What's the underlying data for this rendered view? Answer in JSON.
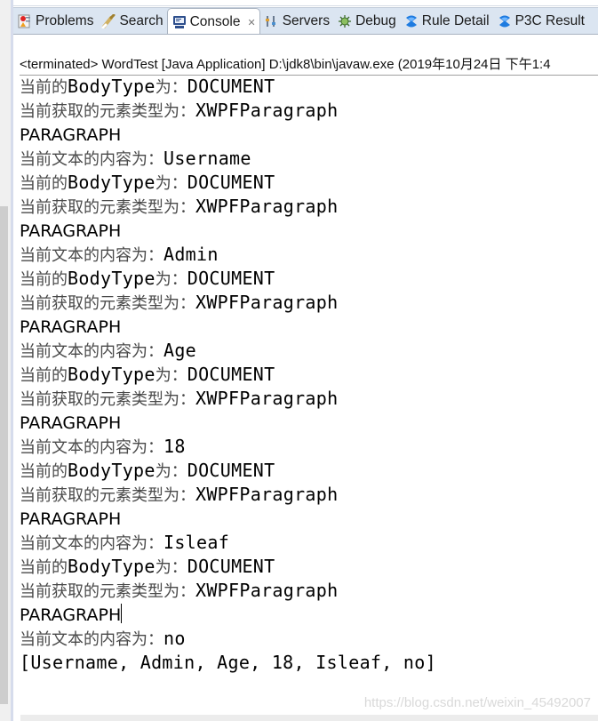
{
  "tabs": [
    {
      "label": "Problems",
      "icon": "problems-icon",
      "active": false
    },
    {
      "label": "Search",
      "icon": "search-icon",
      "active": false
    },
    {
      "label": "Console",
      "icon": "console-icon",
      "active": true,
      "close": "✕"
    },
    {
      "label": "Servers",
      "icon": "servers-icon",
      "active": false
    },
    {
      "label": "Debug",
      "icon": "debug-icon",
      "active": false
    },
    {
      "label": "Rule Detail",
      "icon": "p3c-icon",
      "active": false
    },
    {
      "label": "P3C Result",
      "icon": "p3c-icon",
      "active": false
    }
  ],
  "console": {
    "status": "<terminated> WordTest [Java Application] D:\\jdk8\\bin\\javaw.exe (2019年10月24日 下午1:4",
    "lines": [
      {
        "cn": "当前的",
        "en": "BodyType",
        "cn2": "为：",
        "en2": "DOCUMENT"
      },
      {
        "cn": "当前获取的元素类型为：",
        "en": "XWPFParagraph"
      },
      {
        "plain": "PARAGRAPH"
      },
      {
        "cn": "当前文本的内容为：",
        "en": "Username"
      },
      {
        "cn": "当前的",
        "en": "BodyType",
        "cn2": "为：",
        "en2": "DOCUMENT"
      },
      {
        "cn": "当前获取的元素类型为：",
        "en": "XWPFParagraph"
      },
      {
        "plain": "PARAGRAPH"
      },
      {
        "cn": "当前文本的内容为：",
        "en": "Admin"
      },
      {
        "cn": "当前的",
        "en": "BodyType",
        "cn2": "为：",
        "en2": "DOCUMENT"
      },
      {
        "cn": "当前获取的元素类型为：",
        "en": "XWPFParagraph"
      },
      {
        "plain": "PARAGRAPH"
      },
      {
        "cn": "当前文本的内容为：",
        "en": "Age"
      },
      {
        "cn": "当前的",
        "en": "BodyType",
        "cn2": "为：",
        "en2": "DOCUMENT"
      },
      {
        "cn": "当前获取的元素类型为：",
        "en": "XWPFParagraph"
      },
      {
        "plain": "PARAGRAPH"
      },
      {
        "cn": "当前文本的内容为：",
        "en": "18"
      },
      {
        "cn": "当前的",
        "en": "BodyType",
        "cn2": "为：",
        "en2": "DOCUMENT"
      },
      {
        "cn": "当前获取的元素类型为：",
        "en": "XWPFParagraph"
      },
      {
        "plain": "PARAGRAPH"
      },
      {
        "cn": "当前文本的内容为：",
        "en": "Isleaf"
      },
      {
        "cn": "当前的",
        "en": "BodyType",
        "cn2": "为：",
        "en2": "DOCUMENT"
      },
      {
        "cn": "当前获取的元素类型为：",
        "en": "XWPFParagraph"
      },
      {
        "plain": "PARAGRAPH",
        "caret": true
      },
      {
        "cn": "当前文本的内容为：",
        "en": "no"
      },
      {
        "mono": "[Username, Admin, Age, 18, Isleaf, no]"
      }
    ]
  },
  "watermark": "https://blog.csdn.net/weixin_45492007"
}
